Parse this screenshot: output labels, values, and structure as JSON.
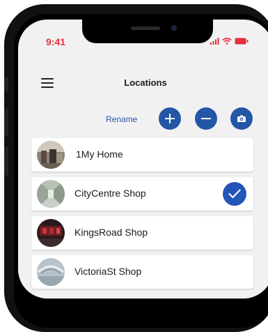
{
  "status": {
    "time": "9:41"
  },
  "header": {
    "title": "Locations"
  },
  "toolbar": {
    "rename_label": "Rename"
  },
  "locations": [
    {
      "name": "1My Home",
      "selected": false
    },
    {
      "name": "CityCentre Shop",
      "selected": true
    },
    {
      "name": "KingsRoad Shop",
      "selected": false
    },
    {
      "name": "VictoriaSt Shop",
      "selected": false
    }
  ],
  "colors": {
    "accent": "#2456a6",
    "time": "#e5303b",
    "status_icons": "#e5303b",
    "background": "#f1f1f2"
  },
  "icons": {
    "menu": "hamburger-menu-icon",
    "add": "plus-icon",
    "remove": "minus-icon",
    "camera": "camera-icon",
    "selected": "checkmark-icon"
  }
}
